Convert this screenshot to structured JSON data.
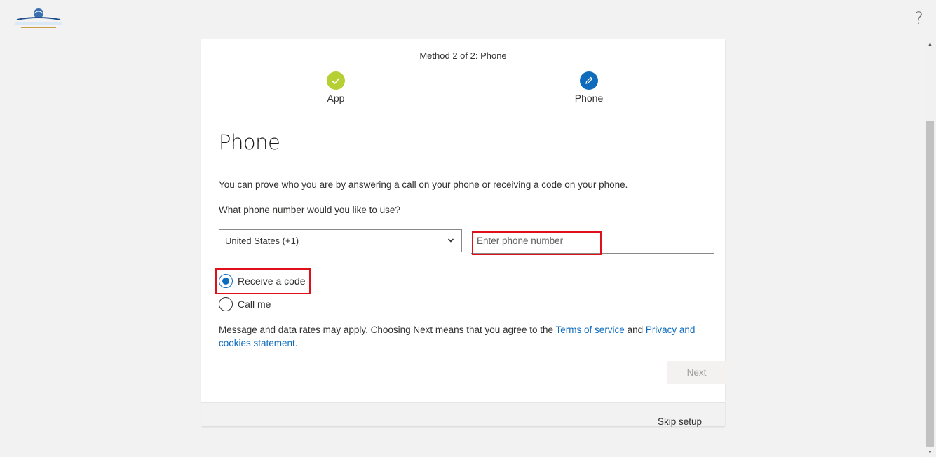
{
  "header": {
    "logo_icon": "health-choice-network-logo",
    "help_label": "?"
  },
  "progress": {
    "title": "Method 2 of 2: Phone",
    "steps": [
      {
        "label": "App",
        "state": "complete",
        "icon": "check-icon",
        "color": "#b6cf33"
      },
      {
        "label": "Phone",
        "state": "current",
        "icon": "pencil-icon",
        "color": "#0f6cbd"
      }
    ]
  },
  "main": {
    "heading": "Phone",
    "description": "You can prove who you are by answering a call on your phone or receiving a code on your phone.",
    "question": "What phone number would you like to use?",
    "country_select": {
      "value": "United States (+1)"
    },
    "phone_input": {
      "placeholder": "Enter phone number",
      "value": ""
    },
    "options": [
      {
        "label": "Receive a code",
        "checked": true
      },
      {
        "label": "Call me",
        "checked": false
      }
    ],
    "notice": {
      "text_before": "Message and data rates may apply. Choosing Next means that you agree to the ",
      "terms_link": "Terms of service",
      "text_and": " and ",
      "privacy_link": "Privacy and cookies statement.",
      "text_after": ""
    },
    "next_label": "Next"
  },
  "footer": {
    "skip_label": "Skip setup"
  },
  "colors": {
    "accent": "#0f6cbd",
    "complete": "#b6cf33",
    "highlight": "#e0101a"
  }
}
